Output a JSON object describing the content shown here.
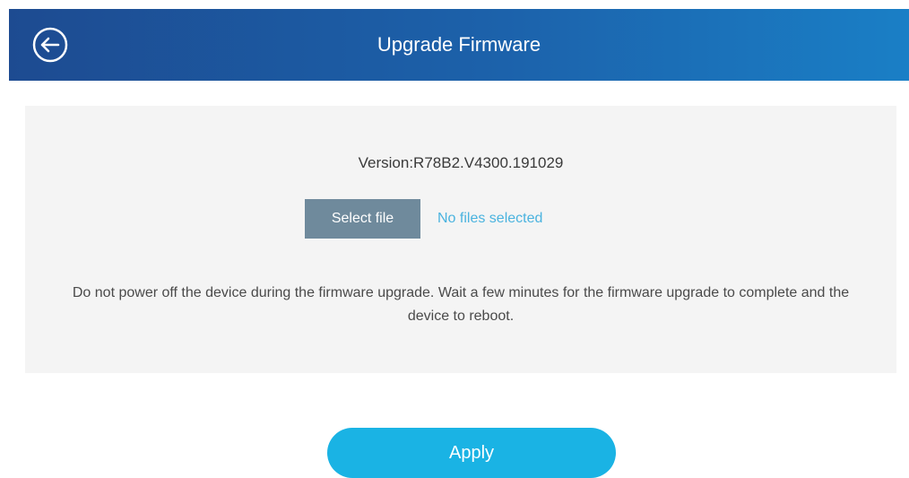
{
  "header": {
    "title": "Upgrade Firmware",
    "back_icon": "back-arrow-circle-icon"
  },
  "firmware": {
    "version_text": "Version:R78B2.V4300.191029",
    "select_file_label": "Select file",
    "file_status": "No files selected",
    "notice": "Do not power off the device during the firmware upgrade. Wait a few minutes for the firmware upgrade to complete and the device to reboot."
  },
  "actions": {
    "apply_label": "Apply"
  },
  "colors": {
    "header_start": "#1d4b91",
    "header_end": "#1a7fc6",
    "panel_bg": "#f4f4f4",
    "select_button": "#6f8a9c",
    "status_text": "#4ab3df",
    "apply_button": "#1ab3e4"
  }
}
